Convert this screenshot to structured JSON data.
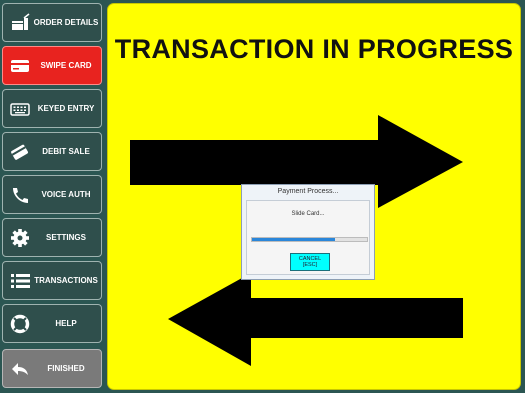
{
  "sidebar": {
    "items": [
      {
        "label": "ORDER DETAILS",
        "icon": "order-details-icon",
        "state": "normal"
      },
      {
        "label": "SWIPE CARD",
        "icon": "credit-card-icon",
        "state": "active"
      },
      {
        "label": "KEYED ENTRY",
        "icon": "keyboard-icon",
        "state": "normal"
      },
      {
        "label": "DEBIT SALE",
        "icon": "debit-card-icon",
        "state": "normal"
      },
      {
        "label": "VOICE AUTH",
        "icon": "phone-icon",
        "state": "normal"
      },
      {
        "label": "SETTINGS",
        "icon": "gear-icon",
        "state": "normal"
      },
      {
        "label": "TRANSACTIONS",
        "icon": "list-icon",
        "state": "normal"
      },
      {
        "label": "HELP",
        "icon": "lifebuoy-icon",
        "state": "normal"
      },
      {
        "label": "FINISHED",
        "icon": "return-arrow-icon",
        "state": "disabled"
      }
    ]
  },
  "main": {
    "title": "TRANSACTION IN PROGRESS",
    "arrows": [
      "right-arrow-icon",
      "left-arrow-icon"
    ]
  },
  "dialog": {
    "title": "Payment Process...",
    "message": "Slide Card...",
    "progress": 0.72,
    "cancel_label": "CANCEL",
    "cancel_hotkey": "[ESC]"
  },
  "colors": {
    "sidebar_bg": "#2b5652",
    "button_bg": "#2f4f4c",
    "active_button": "#e8231f",
    "panel_bg": "#ffff00",
    "cancel_bg": "#00ffff",
    "progress_fill": "#2a86d9"
  }
}
